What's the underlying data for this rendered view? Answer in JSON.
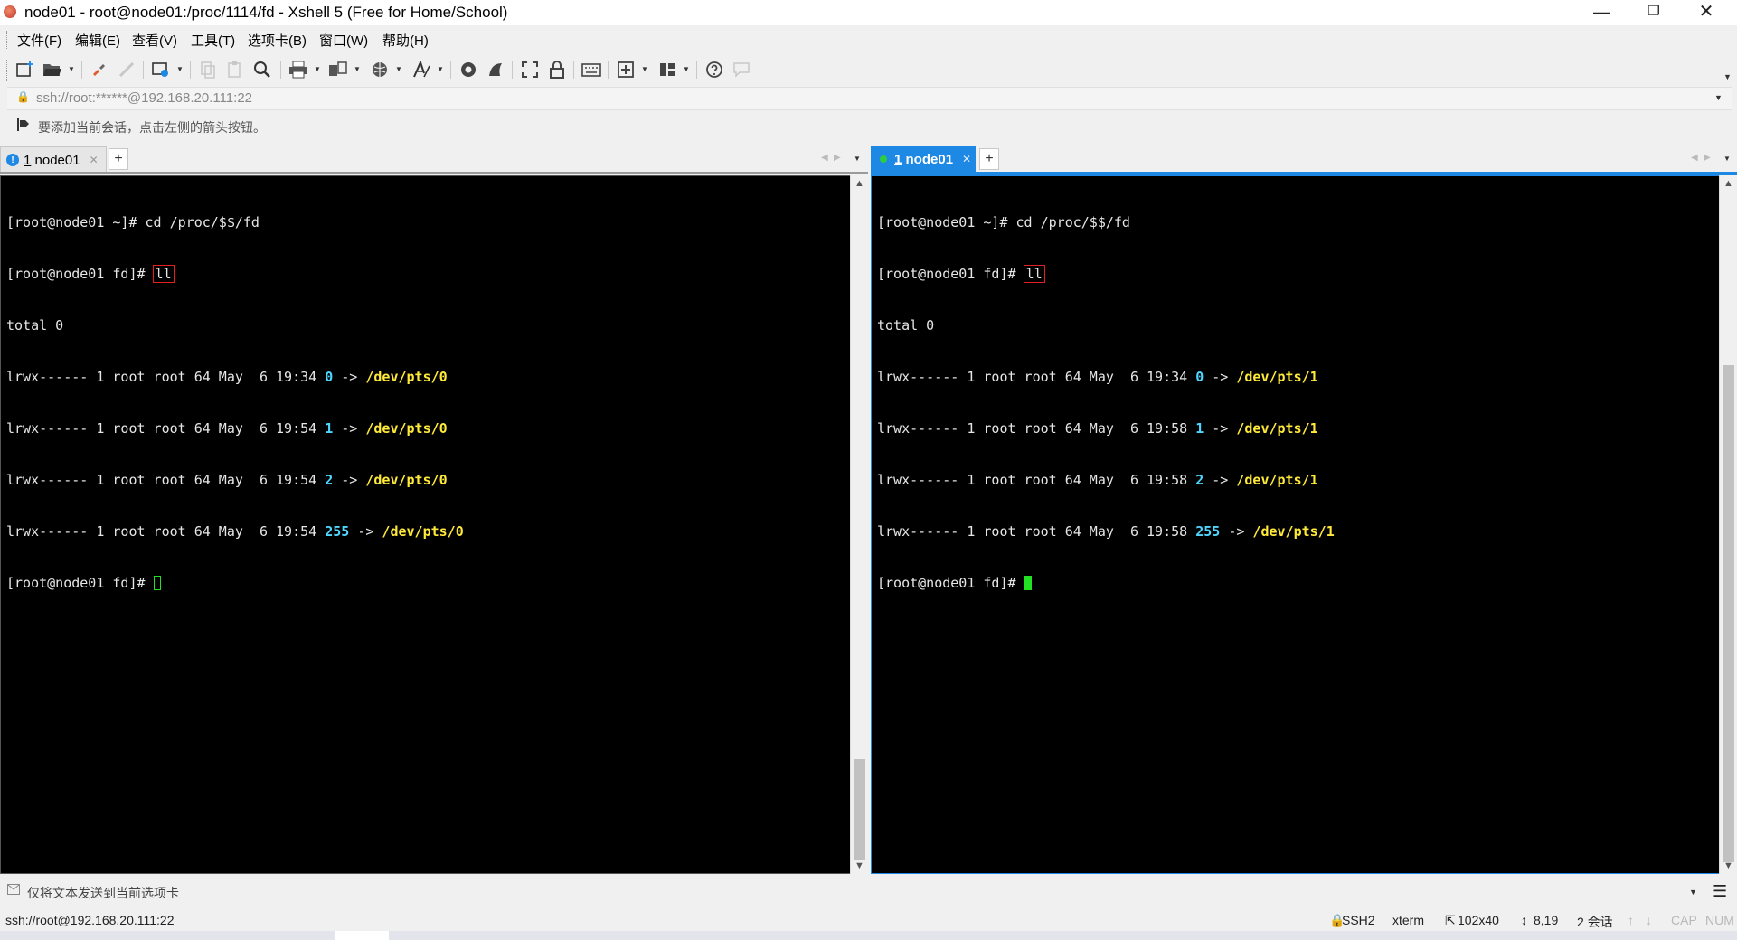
{
  "window": {
    "title": "node01 - root@node01:/proc/1114/fd - Xshell 5 (Free for Home/School)",
    "minimize": "—",
    "maximize": "❐",
    "close": "✕"
  },
  "menu": {
    "file": "文件(F)",
    "edit": "编辑(E)",
    "view": "查看(V)",
    "tools": "工具(T)",
    "tab": "选项卡(B)",
    "window": "窗口(W)",
    "help": "帮助(H)"
  },
  "address": {
    "value": "ssh://root:******@192.168.20.111:22"
  },
  "hint": {
    "text": "要添加当前会话，点击左侧的箭头按钮。"
  },
  "left_pane": {
    "tab": {
      "number": "1",
      "name": "node01",
      "status_icon": "info-icon"
    },
    "lines": {
      "l1": "[root@node01 ~]# cd /proc/$$/fd",
      "l2_prompt": "[root@node01 fd]# ",
      "l2_cmd": "ll",
      "l3": "total 0",
      "r1": {
        "perm": "lrwx------ 1 root root 64 May  6 19:34 ",
        "fd": "0",
        "arrow": " -> ",
        "target": "/dev/pts/0"
      },
      "r2": {
        "perm": "lrwx------ 1 root root 64 May  6 19:54 ",
        "fd": "1",
        "arrow": " -> ",
        "target": "/dev/pts/0"
      },
      "r3": {
        "perm": "lrwx------ 1 root root 64 May  6 19:54 ",
        "fd": "2",
        "arrow": " -> ",
        "target": "/dev/pts/0"
      },
      "r4": {
        "perm": "lrwx------ 1 root root 64 May  6 19:54 ",
        "fd": "255",
        "arrow": " -> ",
        "target": "/dev/pts/0"
      },
      "last_prompt": "[root@node01 fd]# "
    }
  },
  "right_pane": {
    "tab": {
      "number": "1",
      "name": "node01",
      "status_icon": "connected-dot-icon"
    },
    "lines": {
      "l1": "[root@node01 ~]# cd /proc/$$/fd",
      "l2_prompt": "[root@node01 fd]# ",
      "l2_cmd": "ll",
      "l3": "total 0",
      "r1": {
        "perm": "lrwx------ 1 root root 64 May  6 19:34 ",
        "fd": "0",
        "arrow": " -> ",
        "target": "/dev/pts/1"
      },
      "r2": {
        "perm": "lrwx------ 1 root root 64 May  6 19:58 ",
        "fd": "1",
        "arrow": " -> ",
        "target": "/dev/pts/1"
      },
      "r3": {
        "perm": "lrwx------ 1 root root 64 May  6 19:58 ",
        "fd": "2",
        "arrow": " -> ",
        "target": "/dev/pts/1"
      },
      "r4": {
        "perm": "lrwx------ 1 root root 64 May  6 19:58 ",
        "fd": "255",
        "arrow": " -> ",
        "target": "/dev/pts/1"
      },
      "last_prompt": "[root@node01 fd]# "
    }
  },
  "compose": {
    "text": "仅将文本发送到当前选项卡"
  },
  "status": {
    "connection": "ssh://root@192.168.20.111:22",
    "protocol": "SSH2",
    "terminal": "xterm",
    "size": "102x40",
    "cursor": "8,19",
    "sessions": "2 会话",
    "caps": "CAP",
    "num": "NUM"
  },
  "colors": {
    "accent": "#1e88e5",
    "fd_number": "#4fd6ff",
    "symlink_target": "#ffea3a",
    "cursor": "#22e022",
    "command_highlight": "#e02020"
  }
}
